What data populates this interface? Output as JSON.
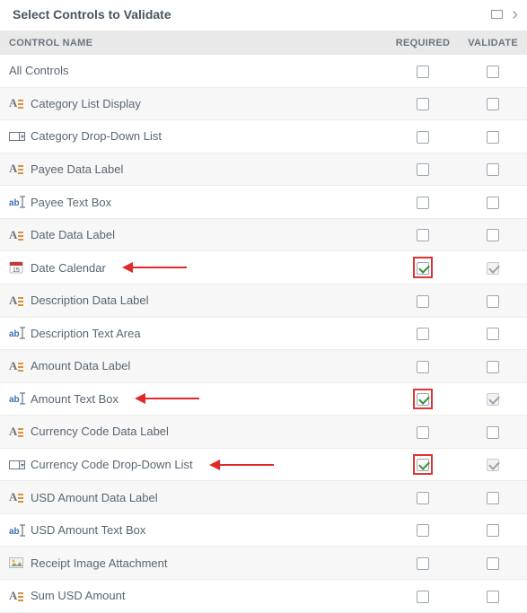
{
  "title": "Select Controls to Validate",
  "columns": {
    "name": "CONTROL NAME",
    "required": "REQUIRED",
    "validate": "VALIDATE"
  },
  "rows": [
    {
      "label": "All Controls",
      "icon": "none",
      "required": false,
      "validate": false,
      "val_disabled": false,
      "highlight": false,
      "arrow_w": 0
    },
    {
      "label": "Category List Display",
      "icon": "alabel",
      "required": false,
      "validate": false,
      "val_disabled": false,
      "highlight": false,
      "arrow_w": 0
    },
    {
      "label": "Category Drop-Down List",
      "icon": "dropdown",
      "required": false,
      "validate": false,
      "val_disabled": false,
      "highlight": false,
      "arrow_w": 0
    },
    {
      "label": "Payee Data Label",
      "icon": "alabel",
      "required": false,
      "validate": false,
      "val_disabled": false,
      "highlight": false,
      "arrow_w": 0
    },
    {
      "label": "Payee Text Box",
      "icon": "textbox",
      "required": false,
      "validate": false,
      "val_disabled": false,
      "highlight": false,
      "arrow_w": 0
    },
    {
      "label": "Date Data Label",
      "icon": "alabel",
      "required": false,
      "validate": false,
      "val_disabled": false,
      "highlight": false,
      "arrow_w": 0
    },
    {
      "label": "Date Calendar",
      "icon": "calendar",
      "required": true,
      "validate": true,
      "val_disabled": true,
      "highlight": true,
      "arrow_w": 72
    },
    {
      "label": "Description Data Label",
      "icon": "alabel",
      "required": false,
      "validate": false,
      "val_disabled": false,
      "highlight": false,
      "arrow_w": 0
    },
    {
      "label": "Description Text Area",
      "icon": "textbox",
      "required": false,
      "validate": false,
      "val_disabled": false,
      "highlight": false,
      "arrow_w": 0
    },
    {
      "label": "Amount Data Label",
      "icon": "alabel",
      "required": false,
      "validate": false,
      "val_disabled": false,
      "highlight": false,
      "arrow_w": 0
    },
    {
      "label": "Amount Text Box",
      "icon": "textbox",
      "required": true,
      "validate": true,
      "val_disabled": true,
      "highlight": true,
      "arrow_w": 72
    },
    {
      "label": "Currency Code Data Label",
      "icon": "alabel",
      "required": false,
      "validate": false,
      "val_disabled": false,
      "highlight": false,
      "arrow_w": 0
    },
    {
      "label": "Currency Code Drop-Down List",
      "icon": "dropdown",
      "required": true,
      "validate": true,
      "val_disabled": true,
      "highlight": true,
      "arrow_w": 72
    },
    {
      "label": "USD Amount Data Label",
      "icon": "alabel",
      "required": false,
      "validate": false,
      "val_disabled": false,
      "highlight": false,
      "arrow_w": 0
    },
    {
      "label": "USD Amount Text Box",
      "icon": "textbox",
      "required": false,
      "validate": false,
      "val_disabled": false,
      "highlight": false,
      "arrow_w": 0
    },
    {
      "label": "Receipt Image Attachment",
      "icon": "image",
      "required": false,
      "validate": false,
      "val_disabled": false,
      "highlight": false,
      "arrow_w": 0
    },
    {
      "label": "Sum USD Amount",
      "icon": "alabel",
      "required": false,
      "validate": false,
      "val_disabled": false,
      "highlight": false,
      "arrow_w": 0
    }
  ]
}
